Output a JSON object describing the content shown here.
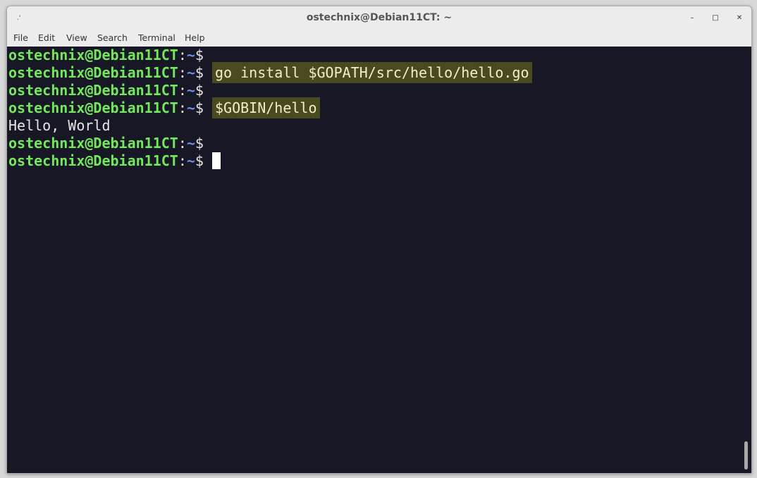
{
  "window": {
    "title": "ostechnix@Debian11CT: ~",
    "left_icon": "pin-icon",
    "controls": {
      "minimize_symbol": "–",
      "maximize_symbol": "□",
      "close_symbol": "✕"
    }
  },
  "menu": {
    "items": [
      "File",
      "Edit",
      "View",
      "Search",
      "Terminal",
      "Help"
    ]
  },
  "terminal": {
    "prompt_user": "ostechnix@Debian11CT",
    "prompt_colon": ":",
    "prompt_path": "~",
    "prompt_dollar": "$",
    "lines": [
      {
        "type": "prompt",
        "command": ""
      },
      {
        "type": "prompt",
        "command": "go install $GOPATH/src/hello/hello.go"
      },
      {
        "type": "prompt",
        "command": ""
      },
      {
        "type": "prompt",
        "command": "$GOBIN/hello"
      },
      {
        "type": "output",
        "text": "Hello, World"
      },
      {
        "type": "prompt",
        "command": ""
      },
      {
        "type": "prompt",
        "command": "",
        "cursor": true
      }
    ]
  },
  "colors": {
    "background": "#181725",
    "user": "#74e85d",
    "path": "#6f8cf0",
    "highlight": "#4a4a1f"
  }
}
